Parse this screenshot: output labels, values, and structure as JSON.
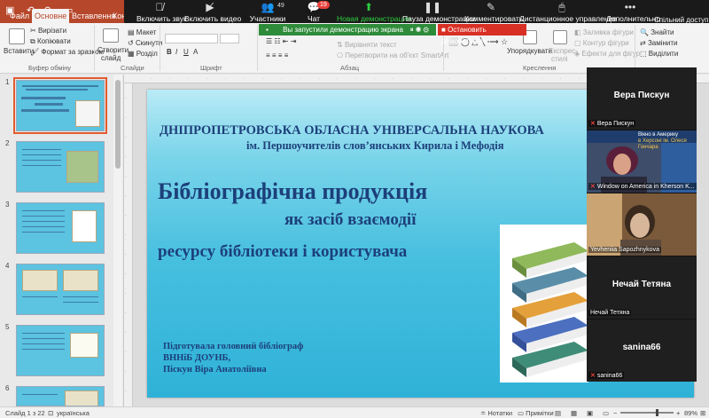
{
  "quick_access": {
    "file_label": "Файл"
  },
  "ribbon_tabs": [
    {
      "label": "Основне",
      "active": true
    },
    {
      "label": "Вставлення",
      "active": false
    },
    {
      "label": "Констр",
      "active": false
    }
  ],
  "zoom_toolbar": {
    "items": [
      {
        "label": "Включить звук",
        "icon": "muted-mic-icon"
      },
      {
        "label": "Включить видео",
        "icon": "video-off-icon"
      },
      {
        "label": "Участники",
        "icon": "participants-icon",
        "count": "49"
      },
      {
        "label": "Чат",
        "icon": "chat-icon",
        "badge": "19"
      },
      {
        "label": "Новая демонстрация",
        "icon": "new-share-icon"
      },
      {
        "label": "Пауза демонстрации",
        "icon": "pause-icon"
      },
      {
        "label": "Комментировать",
        "icon": "annotate-icon"
      },
      {
        "label": "Дистанционное управление",
        "icon": "remote-control-icon"
      },
      {
        "label": "Дополнительно",
        "icon": "more-icon"
      }
    ],
    "share_access": "Спільний доступ"
  },
  "share_banner": {
    "message": "Вы запустили демонстрацию экрана",
    "stop": "Остановить демонстрацию"
  },
  "ribbon": {
    "paste": "Вставити",
    "cut": "Вирізати",
    "copy": "Копіювати",
    "format_painter": "Формат за зразком",
    "clipboard_group": "Буфер обміну",
    "new_slide_1": "Створити",
    "new_slide_2": "слайд",
    "layout": "Макет",
    "reset": "Скинути",
    "section": "Розділ",
    "slides_group": "Слайди",
    "font_group": "Шрифт",
    "align_text": "Вирівняти текст",
    "convert_smartart": "Перетворити на об'єкт SmartArt",
    "paragraph_group": "Абзац",
    "arrange": "Упорядкувати",
    "quick_styles_1": "Експрес-",
    "quick_styles_2": "стилі",
    "drawing_group": "Креслення",
    "shape_fill": "Заливка фігури",
    "shape_outline": "Контур фігури",
    "shape_effects": "Ефекти для фігур",
    "find": "Знайти",
    "replace": "Замінити",
    "select": "Виділити"
  },
  "thumbnails": [
    {
      "number": "1",
      "selected": true
    },
    {
      "number": "2",
      "selected": false
    },
    {
      "number": "3",
      "selected": false
    },
    {
      "number": "4",
      "selected": false
    },
    {
      "number": "5",
      "selected": false
    },
    {
      "number": "6",
      "selected": false
    }
  ],
  "slide": {
    "title_line1": "ДНІПРОПЕТРОВСЬКА ОБЛАСНА УНІВЕРСАЛЬНА НАУКОВА",
    "title_line2": "ім. Першоучителів слов’янських Кирила і Мефодія",
    "heading1": "Бібліографічна   продукція",
    "heading2": "як засіб взаємодії",
    "heading3": "ресурсу бібліотеки і користувача",
    "author_line1": "Підготувала головний бібліограф",
    "author_line2": "ВННіБ ДОУНБ,",
    "author_line3": "Піскун Віра Анатоліївна"
  },
  "gallery": [
    {
      "display_name": "Вера Пискун",
      "tag": "Вера Пискун",
      "muted": true,
      "video": false
    },
    {
      "display_name": "",
      "tag": "Window on America in Kherson K...",
      "muted": true,
      "video": true,
      "overlay_line1": "Вікно в Америку",
      "overlay_line2": "в Херсоні ім. Олеся Гончара"
    },
    {
      "display_name": "",
      "tag": "Yevheniia Sapozhnykova",
      "muted": false,
      "video": true
    },
    {
      "display_name": "Нечай Тетяна",
      "tag": "Нечай Тетяна",
      "muted": false,
      "video": false
    },
    {
      "display_name": "sanina66",
      "tag": "sanina66",
      "muted": true,
      "video": false
    }
  ],
  "status_bar": {
    "slide_counter": "Слайд 1 з 22",
    "language": "українська",
    "notes": "Нотатки",
    "comments": "Примітки",
    "zoom": "89%",
    "zoom_fraction": 0.7
  },
  "colors": {
    "ppt_red": "#b7472a",
    "zoom_green": "#2ecc40",
    "stop_red": "#d93025",
    "slide_text": "#1c3f7a"
  }
}
